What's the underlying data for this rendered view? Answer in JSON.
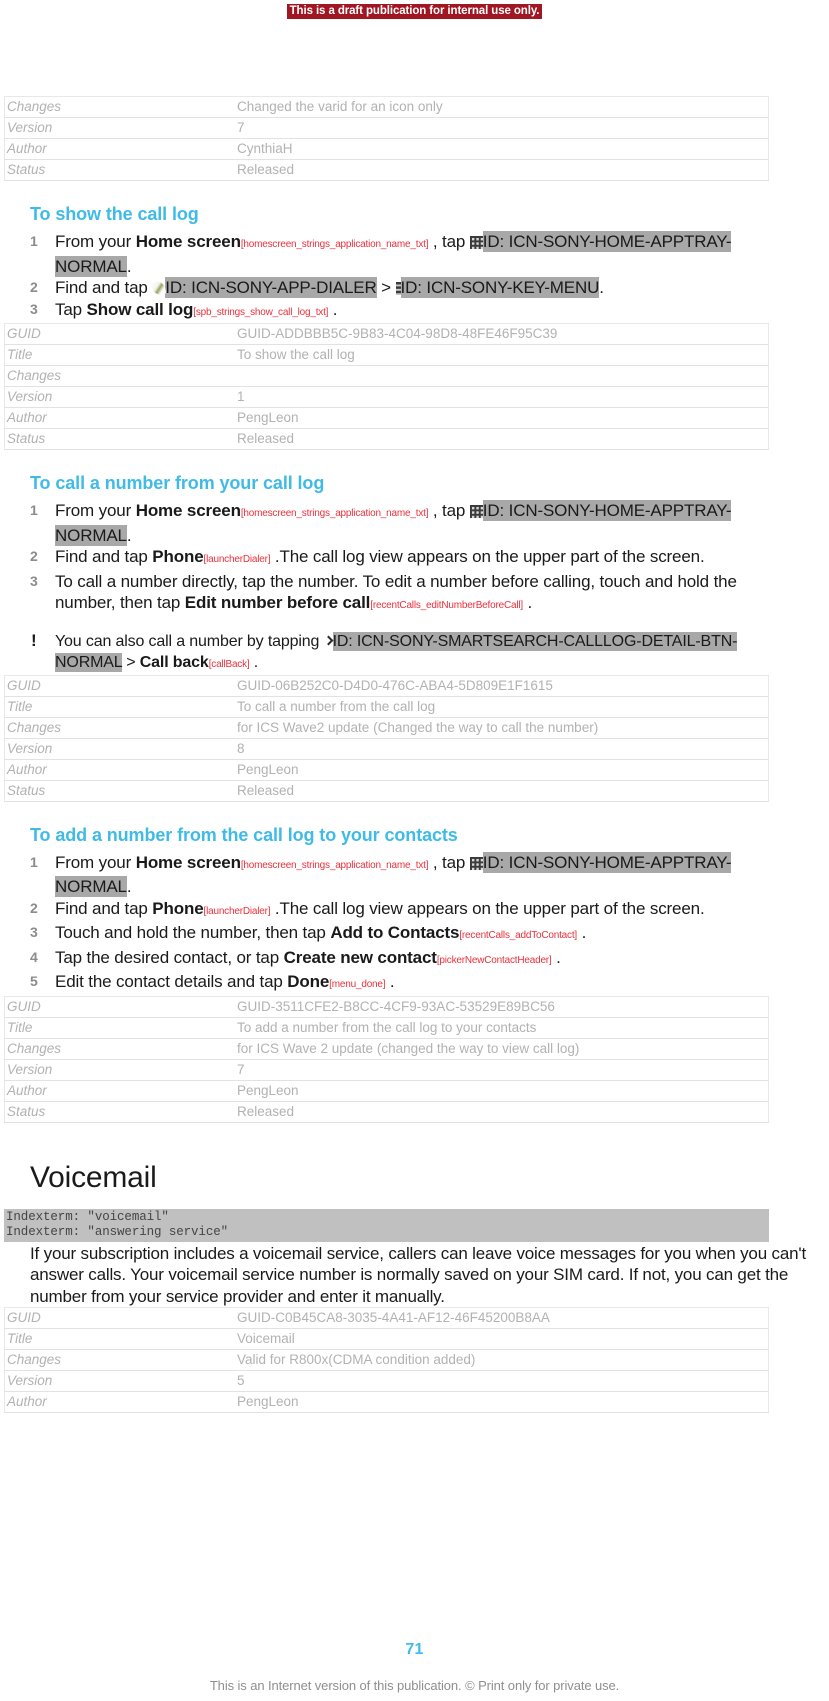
{
  "banner": {
    "draft_notice": "This is a draft publication for internal use only."
  },
  "meta_label_keys": [
    "GUID",
    "Title",
    "Changes",
    "Version",
    "Author",
    "Status"
  ],
  "top_table": {
    "rows": [
      {
        "key": "Changes",
        "value": "Changed the varid for an icon only"
      },
      {
        "key": "Version",
        "value": "7"
      },
      {
        "key": "Author",
        "value": "CynthiaH"
      },
      {
        "key": "Status",
        "value": "Released"
      }
    ]
  },
  "section_show_call_log": {
    "title": "To show the call log",
    "steps": [
      {
        "num": "1",
        "parts": [
          {
            "t": "text",
            "v": "From your "
          },
          {
            "t": "bold",
            "v": "Home screen"
          },
          {
            "t": "varid",
            "v": "[homescreen_strings_application_name_txt]"
          },
          {
            "t": "text",
            "v": " , tap "
          },
          {
            "t": "icon",
            "v": "apptray-icon"
          },
          {
            "t": "idref",
            "v": "ID: ICN-SONY-HOME-APPTRAY-NORMAL"
          },
          {
            "t": "text",
            "v": "."
          }
        ]
      },
      {
        "num": "2",
        "parts": [
          {
            "t": "text",
            "v": "Find and tap "
          },
          {
            "t": "icon",
            "v": "dialer-icon"
          },
          {
            "t": "idref",
            "v": "ID: ICN-SONY-APP-DIALER"
          },
          {
            "t": "text",
            "v": " > "
          },
          {
            "t": "icon",
            "v": "key-menu-icon"
          },
          {
            "t": "idref",
            "v": "ID: ICN-SONY-KEY-MENU"
          },
          {
            "t": "text",
            "v": "."
          }
        ]
      },
      {
        "num": "3",
        "parts": [
          {
            "t": "text",
            "v": "Tap "
          },
          {
            "t": "bold",
            "v": "Show call log"
          },
          {
            "t": "varid",
            "v": "[spb_strings_show_call_log_txt]"
          },
          {
            "t": "text",
            "v": " ."
          }
        ]
      }
    ],
    "table": {
      "rows": [
        {
          "key": "GUID",
          "value": "GUID-ADDBBB5C-9B83-4C04-98D8-48FE46F95C39"
        },
        {
          "key": "Title",
          "value": "To show the call log"
        },
        {
          "key": "Changes",
          "value": ""
        },
        {
          "key": "Version",
          "value": "1"
        },
        {
          "key": "Author",
          "value": "PengLeon"
        },
        {
          "key": "Status",
          "value": "Released"
        }
      ]
    }
  },
  "section_call_a_number": {
    "title": "To call a number from your call log",
    "steps": [
      {
        "num": "1",
        "parts": [
          {
            "t": "text",
            "v": "From your "
          },
          {
            "t": "bold",
            "v": "Home screen"
          },
          {
            "t": "varid",
            "v": "[homescreen_strings_application_name_txt]"
          },
          {
            "t": "text",
            "v": " , tap "
          },
          {
            "t": "icon",
            "v": "apptray-icon"
          },
          {
            "t": "idref",
            "v": "ID: ICN-SONY-HOME-APPTRAY-NORMAL"
          },
          {
            "t": "text",
            "v": "."
          }
        ]
      },
      {
        "num": "2",
        "parts": [
          {
            "t": "text",
            "v": "Find and tap "
          },
          {
            "t": "bold",
            "v": "Phone"
          },
          {
            "t": "varid",
            "v": "[launcherDialer]"
          },
          {
            "t": "text",
            "v": " .The call log view appears on the upper part of the screen."
          }
        ]
      },
      {
        "num": "3",
        "parts": [
          {
            "t": "text",
            "v": "To call a number directly, tap the number. To edit a number before calling, touch and hold the number, then tap "
          },
          {
            "t": "bold",
            "v": "Edit number before call"
          },
          {
            "t": "varid",
            "v": "[recentCalls_editNumberBe­foreCall]"
          },
          {
            "t": "text",
            "v": " ."
          }
        ]
      }
    ],
    "note": {
      "marker": "!",
      "parts": [
        {
          "t": "text",
          "v": "You can also call a number by tapping "
        },
        {
          "t": "icon",
          "v": "chevron-right-icon"
        },
        {
          "t": "idref",
          "v": "ID: ICN-SONY-SMARTSEARCH-CALLLOG-DETAIL-BTN-NORMAL"
        },
        {
          "t": "text",
          "v": " > "
        },
        {
          "t": "bold",
          "v": "Call back"
        },
        {
          "t": "varid",
          "v": "[callBack]"
        },
        {
          "t": "text",
          "v": " ."
        }
      ]
    },
    "table": {
      "rows": [
        {
          "key": "GUID",
          "value": "GUID-06B252C0-D4D0-476C-ABA4-5D809E1F1615"
        },
        {
          "key": "Title",
          "value": "To call a number from the call log"
        },
        {
          "key": "Changes",
          "value": "for ICS Wave2 update (Changed the way to call the number)"
        },
        {
          "key": "Version",
          "value": "8"
        },
        {
          "key": "Author",
          "value": "PengLeon"
        },
        {
          "key": "Status",
          "value": "Released"
        }
      ]
    }
  },
  "section_add_number": {
    "title": "To add a number from the call log to your contacts",
    "steps": [
      {
        "num": "1",
        "parts": [
          {
            "t": "text",
            "v": "From your "
          },
          {
            "t": "bold",
            "v": "Home screen"
          },
          {
            "t": "varid",
            "v": "[homescreen_strings_application_name_txt]"
          },
          {
            "t": "text",
            "v": " , tap "
          },
          {
            "t": "icon",
            "v": "apptray-icon"
          },
          {
            "t": "idref",
            "v": "ID: ICN-SONY-HOME-APPTRAY-NORMAL"
          },
          {
            "t": "text",
            "v": "."
          }
        ]
      },
      {
        "num": "2",
        "parts": [
          {
            "t": "text",
            "v": "Find and tap "
          },
          {
            "t": "bold",
            "v": "Phone"
          },
          {
            "t": "varid",
            "v": "[launcherDialer]"
          },
          {
            "t": "text",
            "v": " .The call log view appears on the upper part of the screen."
          }
        ]
      },
      {
        "num": "3",
        "parts": [
          {
            "t": "text",
            "v": "Touch and hold the number, then tap "
          },
          {
            "t": "bold",
            "v": "Add to Contacts"
          },
          {
            "t": "varid",
            "v": "[recentCalls_addToContact]"
          },
          {
            "t": "text",
            "v": " ."
          }
        ]
      },
      {
        "num": "4",
        "parts": [
          {
            "t": "text",
            "v": "Tap the desired contact, or tap "
          },
          {
            "t": "bold",
            "v": "Create new contact"
          },
          {
            "t": "varid",
            "v": "[pickerNewContactHeader]"
          },
          {
            "t": "text",
            "v": " ."
          }
        ]
      },
      {
        "num": "5",
        "parts": [
          {
            "t": "text",
            "v": "Edit the contact details and tap "
          },
          {
            "t": "bold",
            "v": "Done"
          },
          {
            "t": "varid",
            "v": "[menu_done]"
          },
          {
            "t": "text",
            "v": " ."
          }
        ]
      }
    ],
    "table": {
      "rows": [
        {
          "key": "GUID",
          "value": "GUID-3511CFE2-B8CC-4CF9-93AC-53529E89BC56"
        },
        {
          "key": "Title",
          "value": "To add a number from the call log to your contacts"
        },
        {
          "key": "Changes",
          "value": "for ICS Wave 2 update (changed the way to view call log)"
        },
        {
          "key": "Version",
          "value": "7"
        },
        {
          "key": "Author",
          "value": "PengLeon"
        },
        {
          "key": "Status",
          "value": "Released"
        }
      ]
    }
  },
  "section_voicemail": {
    "title": "Voicemail",
    "indexterms": [
      "Indexterm: \"voicemail\"",
      "Indexterm: \"answering service\""
    ],
    "body": "If your subscription includes a voicemail service, callers can leave voice messages for you when you can't answer calls. Your voicemail service number is normally saved on your SIM card. If not, you can get the number from your service provider and enter it manually.",
    "table": {
      "rows": [
        {
          "key": "GUID",
          "value": "GUID-C0B45CA8-3035-4A41-AF12-46F45200B8AA"
        },
        {
          "key": "Title",
          "value": "Voicemail"
        },
        {
          "key": "Changes",
          "value": "Valid for R800x(CDMA condition added)"
        },
        {
          "key": "Version",
          "value": "5"
        },
        {
          "key": "Author",
          "value": "PengLeon"
        }
      ]
    }
  },
  "footer": {
    "page_number": "71",
    "notice": "This is an Internet version of this publication. © Print only for private use."
  },
  "colors": {
    "accent": "#3fbbe8",
    "draft_banner_bg": "#a01622",
    "varid_red": "#e8313c",
    "idref_highlight": "#a8a8a8",
    "meta_text": "#b2b2b2",
    "indexterm_bg": "#c0c0c0"
  }
}
